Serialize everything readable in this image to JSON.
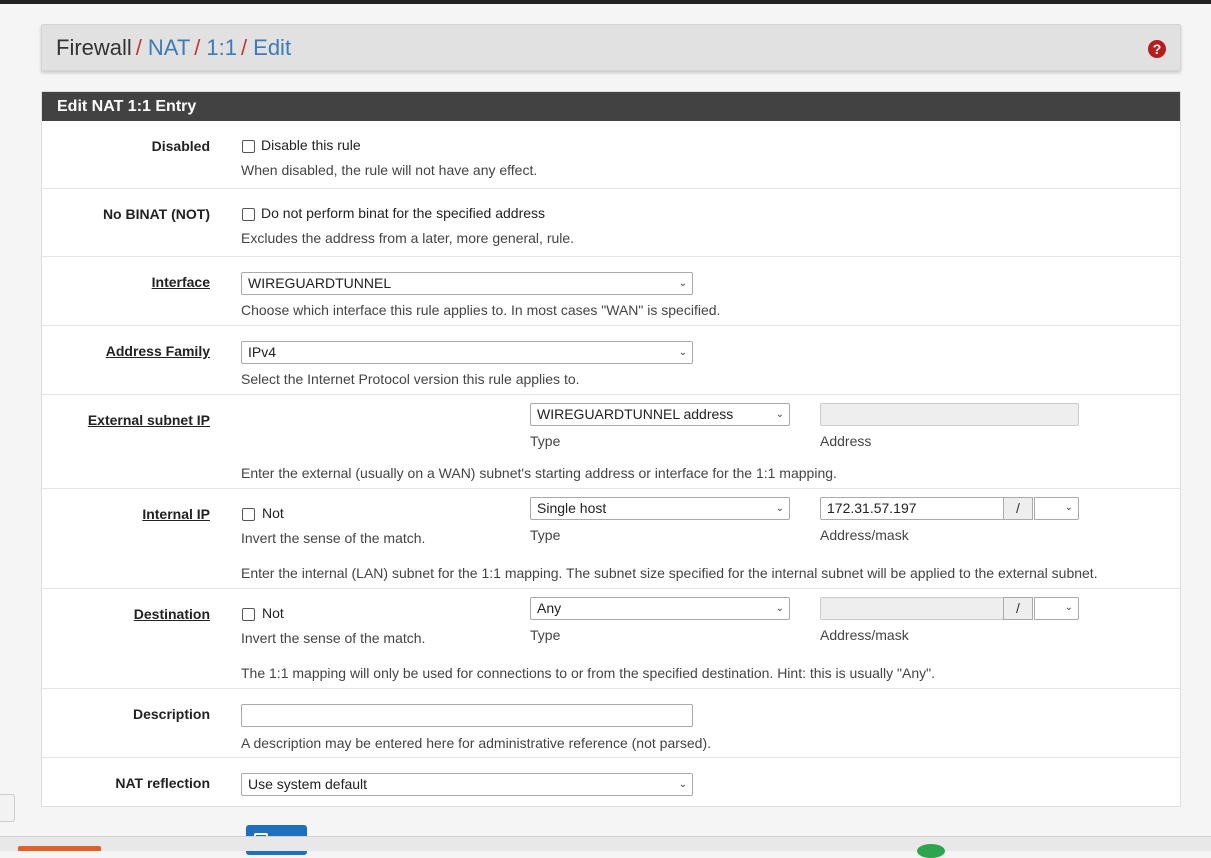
{
  "breadcrumb": {
    "firewall": "Firewall",
    "nat": "NAT",
    "one_to_one": "1:1",
    "edit": "Edit",
    "separator": "/"
  },
  "help_icon": {
    "glyph": "?",
    "icon": "question-circle-icon"
  },
  "panel": {
    "title": "Edit NAT 1:1 Entry"
  },
  "disabled": {
    "label": "Disabled",
    "checkbox_label": "Disable this rule",
    "checked": false,
    "help": "When disabled, the rule will not have any effect."
  },
  "nobinat": {
    "label": "No BINAT (NOT)",
    "checkbox_label": "Do not perform binat for the specified address",
    "checked": false,
    "help": "Excludes the address from a later, more general, rule."
  },
  "interface": {
    "label": "Interface",
    "value": "WIREGUARDTUNNEL",
    "help": "Choose which interface this rule applies to. In most cases \"WAN\" is specified."
  },
  "address_family": {
    "label": "Address Family",
    "value": "IPv4",
    "help": "Select the Internet Protocol version this rule applies to."
  },
  "external_subnet": {
    "label": "External subnet IP",
    "type_value": "WIREGUARDTUNNEL address",
    "type_label": "Type",
    "address_value": "",
    "address_label": "Address",
    "help": "Enter the external (usually on a WAN) subnet's starting address or interface for the 1:1 mapping."
  },
  "internal_ip": {
    "label": "Internal IP",
    "not_label": "Not",
    "not_checked": false,
    "invert_help": "Invert the sense of the match.",
    "type_value": "Single host",
    "type_label": "Type",
    "address_value": "172.31.57.197",
    "mask_sep": "/",
    "address_label": "Address/mask",
    "help": "Enter the internal (LAN) subnet for the 1:1 mapping. The subnet size specified for the internal subnet will be applied to the external subnet."
  },
  "destination": {
    "label": "Destination",
    "not_label": "Not",
    "not_checked": false,
    "invert_help": "Invert the sense of the match.",
    "type_value": "Any",
    "type_label": "Type",
    "address_value": "",
    "mask_sep": "/",
    "address_label": "Address/mask",
    "help": "The 1:1 mapping will only be used for connections to or from the specified destination. Hint: this is usually \"Any\"."
  },
  "description": {
    "label": "Description",
    "value": "",
    "help": "A description may be entered here for administrative reference (not parsed)."
  },
  "nat_reflection": {
    "label": "NAT reflection",
    "value": "Use system default"
  },
  "icons": {
    "select_chevron": "⌄",
    "save": "save-icon"
  }
}
